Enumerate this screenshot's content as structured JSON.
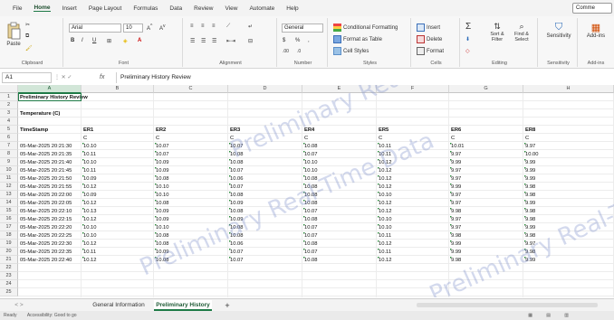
{
  "menu": {
    "tabs": [
      "File",
      "Home",
      "Insert",
      "Page Layout",
      "Formulas",
      "Data",
      "Review",
      "View",
      "Automate",
      "Help"
    ],
    "active_tab": "Home",
    "comments_label": "Comme"
  },
  "ribbon": {
    "clipboard": {
      "paste_label": "Paste",
      "group_label": "Clipboard"
    },
    "font": {
      "font_name": "Arial",
      "font_size": "10",
      "group_label": "Font"
    },
    "alignment": {
      "group_label": "Alignment"
    },
    "number": {
      "format": "General",
      "group_label": "Number"
    },
    "styles": {
      "conditional": "Conditional Formatting",
      "format_table": "Format as Table",
      "cell_styles": "Cell Styles",
      "group_label": "Styles"
    },
    "cells": {
      "insert": "Insert",
      "delete": "Delete",
      "format": "Format",
      "group_label": "Cells"
    },
    "editing": {
      "sort_filter": "Sort & Filter",
      "find_select": "Find & Select",
      "group_label": "Editing"
    },
    "sensitivity": {
      "label": "Sensitivity",
      "group_label": "Sensitivity"
    },
    "addins": {
      "label": "Add-ins",
      "group_label": "Add-ins"
    }
  },
  "formula_bar": {
    "name_box": "A1",
    "formula": "Preliminary History Review",
    "fx": "fx",
    "icons": "⋮  ✕  ✓"
  },
  "sheet": {
    "columns": [
      "A",
      "B",
      "C",
      "D",
      "E",
      "F",
      "G",
      "H"
    ],
    "title": "Preliminary History Review",
    "subtitle": "Temperature (C)",
    "header_row": [
      "TimeStamp",
      "ER1",
      "ER2",
      "ER3",
      "ER4",
      "ER5",
      "ER6",
      "ER8"
    ],
    "unit_row": [
      "",
      "C",
      "C",
      "C",
      "C",
      "C",
      "C",
      "C"
    ],
    "rows": [
      [
        "05-Mar-2025 20:21:30",
        "10.10",
        "10.07",
        "10.07",
        "10.08",
        "10.11",
        "10.01",
        "9.97"
      ],
      [
        "05-Mar-2025 20:21:35",
        "10.11",
        "10.07",
        "10.08",
        "10.07",
        "10.11",
        "9.97",
        "10.00"
      ],
      [
        "05-Mar-2025 20:21:40",
        "10.10",
        "10.09",
        "10.08",
        "10.10",
        "10.12",
        "9.99",
        "9.99"
      ],
      [
        "05-Mar-2025 20:21:45",
        "10.11",
        "10.09",
        "10.07",
        "10.10",
        "10.12",
        "9.97",
        "9.99"
      ],
      [
        "05-Mar-2025 20:21:50",
        "10.09",
        "10.08",
        "10.06",
        "10.08",
        "10.12",
        "9.97",
        "9.99"
      ],
      [
        "05-Mar-2025 20:21:55",
        "10.12",
        "10.10",
        "10.07",
        "10.08",
        "10.12",
        "9.99",
        "9.98"
      ],
      [
        "05-Mar-2025 20:22:00",
        "10.09",
        "10.10",
        "10.08",
        "10.08",
        "10.10",
        "9.97",
        "9.98"
      ],
      [
        "05-Mar-2025 20:22:05",
        "10.12",
        "10.08",
        "10.09",
        "10.08",
        "10.12",
        "9.97",
        "9.99"
      ],
      [
        "05-Mar-2025 20:22:10",
        "10.13",
        "10.09",
        "10.08",
        "10.07",
        "10.12",
        "9.98",
        "9.98"
      ],
      [
        "05-Mar-2025 20:22:15",
        "10.12",
        "10.09",
        "10.09",
        "10.08",
        "10.10",
        "9.97",
        "9.98"
      ],
      [
        "05-Mar-2025 20:22:20",
        "10.10",
        "10.10",
        "10.08",
        "10.07",
        "10.10",
        "9.97",
        "9.99"
      ],
      [
        "05-Mar-2025 20:22:25",
        "10.10",
        "10.08",
        "10.08",
        "10.07",
        "10.11",
        "9.98",
        "9.98"
      ],
      [
        "05-Mar-2025 20:22:30",
        "10.12",
        "10.08",
        "10.06",
        "10.08",
        "10.12",
        "9.99",
        "9.97"
      ],
      [
        "05-Mar-2025 20:22:35",
        "10.11",
        "10.09",
        "10.07",
        "10.07",
        "10.11",
        "9.99",
        "9.98"
      ],
      [
        "05-Mar-2025 20:22:40",
        "10.12",
        "10.08",
        "10.07",
        "10.08",
        "10.12",
        "9.98",
        "9.99"
      ]
    ],
    "watermark": "Preliminary Real-Time Data"
  },
  "tabs": {
    "sheets": [
      "General Information",
      "Preliminary History"
    ],
    "active": "Preliminary History",
    "add": "+",
    "nav": "<  >"
  },
  "status": {
    "ready": "Ready",
    "accessibility": "Accessibility: Good to go"
  }
}
